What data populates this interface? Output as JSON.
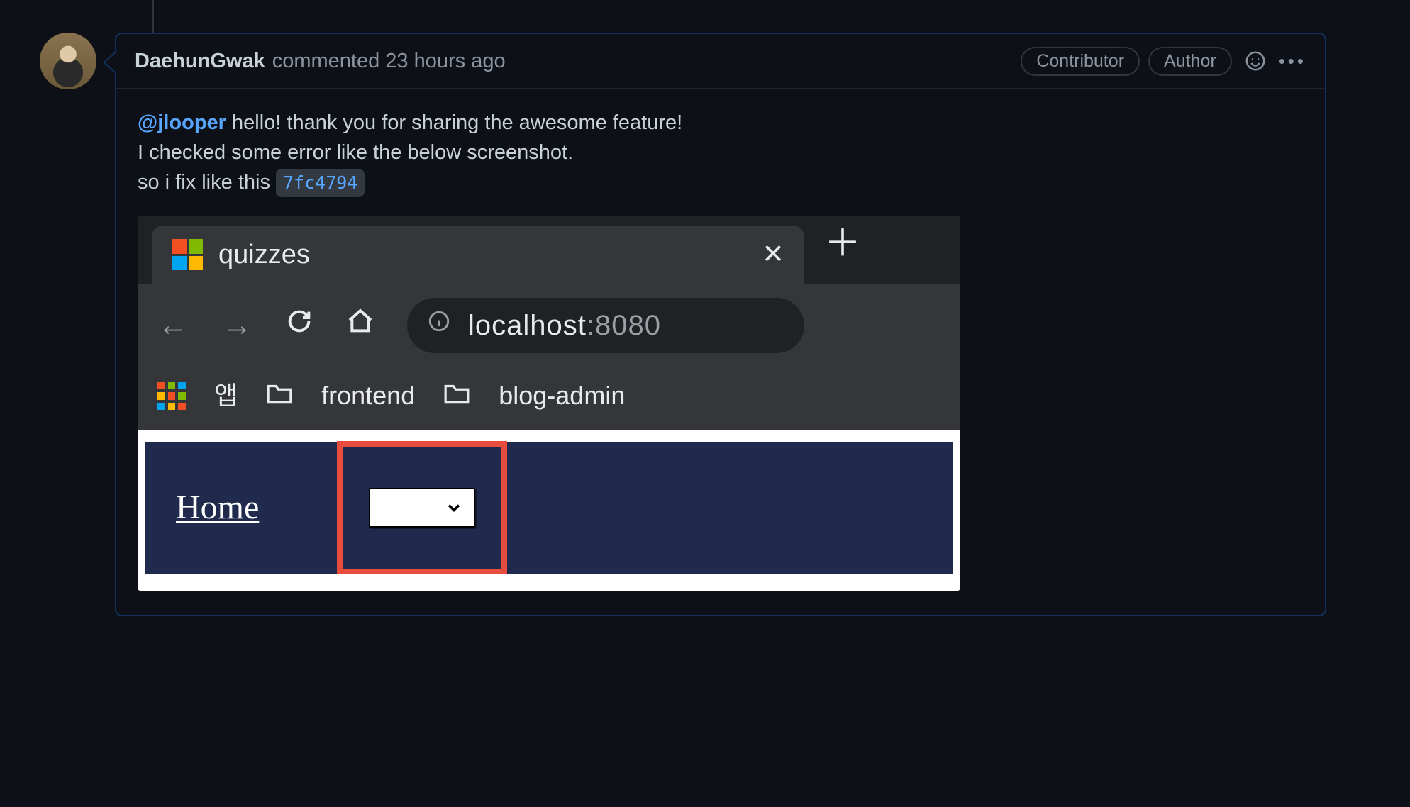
{
  "comment": {
    "author": "DaehunGwak",
    "meta_action": "commented",
    "meta_time": "23 hours ago",
    "badges": {
      "contributor": "Contributor",
      "author": "Author"
    },
    "body": {
      "mention": "@jlooper",
      "line1_rest": " hello! thank you for sharing the awesome feature!",
      "line2": "I checked some error like the below screenshot.",
      "line3_pre": "so i fix like this ",
      "commit_sha": "7fc4794"
    }
  },
  "embed": {
    "tab_title": "quizzes",
    "url_host": "localhost",
    "url_port": ":8080",
    "bookmarks": {
      "apps_label": "앱",
      "bm1": "frontend",
      "bm2": "blog-admin"
    },
    "page": {
      "home_label": "Home"
    }
  }
}
